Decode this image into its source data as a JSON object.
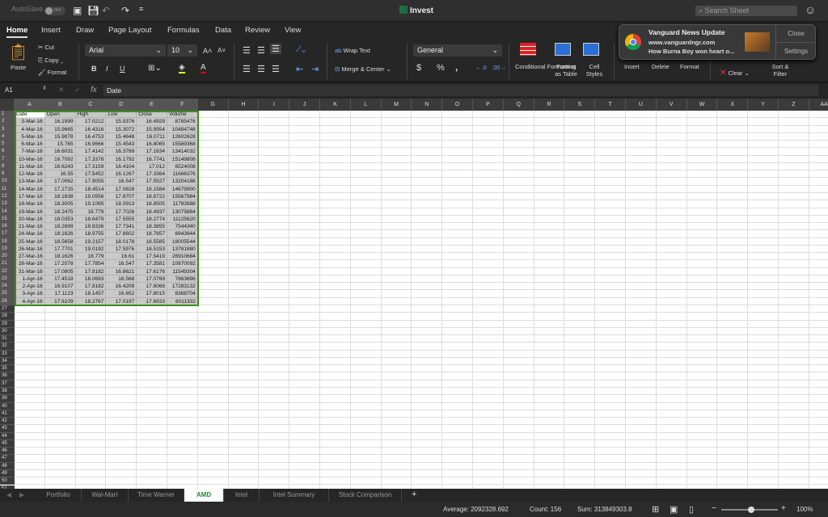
{
  "titlebar": {
    "autosave": "AutoSave",
    "autosave_state": "OFF",
    "title": "Invest",
    "search_placeholder": "Search Sheet"
  },
  "menu_tabs": [
    "Home",
    "Insert",
    "Draw",
    "Page Layout",
    "Formulas",
    "Data",
    "Review",
    "View"
  ],
  "ribbon": {
    "paste": "Paste",
    "cut": "Cut",
    "copy": "Copy",
    "format": "Format",
    "font": "Arial",
    "font_size": "10",
    "bold": "B",
    "italic": "I",
    "underline": "U",
    "wrap_text": "Wrap Text",
    "merge_center": "Merge & Center",
    "number_format": "General",
    "dollar": "$",
    "percent": "%",
    "comma": ",",
    "conditional_formatting": "Conditional Formatting",
    "format_as_table": "Format as Table",
    "cell_styles": "Cell Styles",
    "insert": "Insert",
    "delete": "Delete",
    "format_cells": "Format",
    "clear": "Clear",
    "sort_filter": "Sort & Filter"
  },
  "notification": {
    "title": "Vanguard News Update",
    "site": "www.vanguardngr.com",
    "message": "How Burna Boy won heart o...",
    "close": "Close",
    "settings": "Settings"
  },
  "formula_bar": {
    "name_box": "A1",
    "fx": "fx",
    "value": "Date"
  },
  "columns": [
    "A",
    "B",
    "C",
    "D",
    "E",
    "F",
    "G",
    "H",
    "I",
    "J",
    "K",
    "L",
    "M",
    "N",
    "O",
    "P",
    "Q",
    "R",
    "S",
    "T",
    "U",
    "V",
    "W",
    "X",
    "Y",
    "Z",
    "AA"
  ],
  "table": {
    "headers": [
      "Date",
      "Open",
      "High",
      "Low",
      "Close",
      "Volume"
    ],
    "rows": [
      [
        "3-Mar-16",
        "16.1999",
        "17.0212",
        "15.9376",
        "16.4929",
        "8785476"
      ],
      [
        "4-Mar-16",
        "15.9665",
        "16.4316",
        "15.3072",
        "15.9954",
        "10484748"
      ],
      [
        "5-Mar-16",
        "15.9878",
        "16.4753",
        "15.4648",
        "16.0711",
        "12602628"
      ],
      [
        "6-Mar-16",
        "15.765",
        "16.9666",
        "15.4543",
        "16.8065",
        "15589368"
      ],
      [
        "7-Mar-16",
        "16.6031",
        "17.4142",
        "16.3789",
        "17.1634",
        "13414032"
      ],
      [
        "10-Mar-16",
        "16.7092",
        "17.3378",
        "16.1792",
        "16.7741",
        "15149808"
      ],
      [
        "11-Mar-16",
        "16.6243",
        "17.3159",
        "16.4104",
        "17.012",
        "8524008"
      ],
      [
        "12-Mar-16",
        "16.55",
        "17.5452",
        "16.1267",
        "17.3364",
        "11666376"
      ],
      [
        "13-Mar-16",
        "17.0062",
        "17.9055",
        "16.547",
        "17.5527",
        "13204188"
      ],
      [
        "14-Mar-16",
        "17.2715",
        "18.4514",
        "17.0828",
        "18.1584",
        "14679900"
      ],
      [
        "17-Mar-16",
        "18.1838",
        "19.0956",
        "17.8707",
        "18.8722",
        "15567984"
      ],
      [
        "18-Mar-16",
        "18.3005",
        "19.1065",
        "18.0913",
        "18.8505",
        "11783988"
      ],
      [
        "19-Mar-16",
        "18.2475",
        "18.779",
        "17.7026",
        "18.4937",
        "13075884"
      ],
      [
        "20-Mar-16",
        "18.0353",
        "18.6479",
        "17.5555",
        "18.2774",
        "11125620"
      ],
      [
        "21-Mar-16",
        "18.2899",
        "18.8336",
        "17.7341",
        "18.3855",
        "7544340"
      ],
      [
        "24-Mar-16",
        "18.1626",
        "18.9755",
        "17.8602",
        "18.7857",
        "6943644"
      ],
      [
        "25-Mar-16",
        "18.5658",
        "19.2157",
        "18.0178",
        "18.5585",
        "18005544"
      ],
      [
        "26-Mar-16",
        "17.7701",
        "19.0192",
        "17.5976",
        "18.5153",
        "13781880"
      ],
      [
        "27-Mar-16",
        "18.1626",
        "18.779",
        "16.61",
        "17.5419",
        "26910684"
      ],
      [
        "28-Mar-16",
        "17.2078",
        "17.7854",
        "16.547",
        "17.3581",
        "10870092"
      ],
      [
        "31-Mar-16",
        "17.0805",
        "17.8182",
        "16.8621",
        "17.6176",
        "11549304"
      ],
      [
        "1-Apr-16",
        "17.4518",
        "18.0693",
        "16.568",
        "17.0769",
        "7863696"
      ],
      [
        "2-Apr-16",
        "16.9107",
        "17.8182",
        "16.4209",
        "17.6068",
        "17283132"
      ],
      [
        "3-Apr-16",
        "17.1123",
        "18.1457",
        "16.652",
        "17.8015",
        "8368704"
      ],
      [
        "4-Apr-16",
        "17.6109",
        "18.2767",
        "17.0197",
        "17.6933",
        "8011332"
      ]
    ]
  },
  "sheet_tabs": [
    "Portfolio",
    "Wal-Mart",
    "Time Warner",
    "AMD",
    "Intel",
    "Intel Summary",
    "Stock Comparison"
  ],
  "active_sheet": "AMD",
  "status": {
    "average": "Average: 2092328.692",
    "count": "Count: 156",
    "sum": "Sum: 313849303.8",
    "zoom": "100%"
  },
  "zoom_level_percent": 100,
  "colors": {
    "accent": "#3c8c1c",
    "active_tab_text": "#1d8f3a",
    "selection": "#c9c9c9"
  }
}
